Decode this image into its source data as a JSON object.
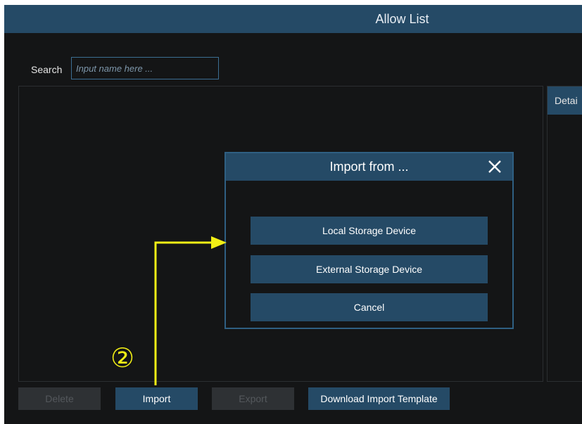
{
  "window": {
    "title": "Allow List"
  },
  "search": {
    "label": "Search",
    "placeholder": "Input name here ..."
  },
  "details": {
    "header": "Detai"
  },
  "toolbar": {
    "delete_label": "Delete",
    "import_label": "Import",
    "export_label": "Export",
    "download_label": "Download Import Template"
  },
  "dialog": {
    "title": "Import from ...",
    "local_label": "Local Storage Device",
    "external_label": "External Storage Device",
    "cancel_label": "Cancel"
  },
  "annotation": {
    "step_marker": "②",
    "color": "#f2ef15"
  },
  "colors": {
    "accent": "#254a66",
    "background": "#141516",
    "border": "#2f5f82"
  }
}
